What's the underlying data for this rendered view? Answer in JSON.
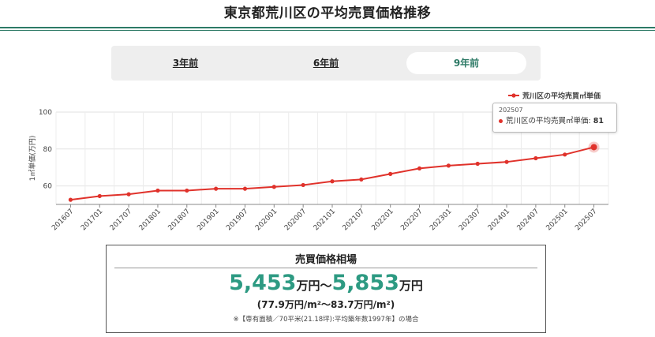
{
  "page": {
    "title": "東京都荒川区の平均売買価格推移"
  },
  "tabs": [
    {
      "label": "3年前",
      "active": false
    },
    {
      "label": "6年前",
      "active": false
    },
    {
      "label": "9年前",
      "active": true
    }
  ],
  "colors": {
    "accent": "#2d7a66",
    "series": "#e0322b",
    "price": "#2d9a82"
  },
  "chart_data": {
    "type": "line",
    "title": "",
    "xlabel": "",
    "ylabel": "1㎡単価(万円)",
    "ylim": [
      50,
      100
    ],
    "yticks": [
      60,
      80,
      100
    ],
    "grid": true,
    "legend_position": "top-right",
    "categories": [
      "201607",
      "201701",
      "201707",
      "201801",
      "201807",
      "201901",
      "201907",
      "202001",
      "202007",
      "202101",
      "202107",
      "202201",
      "202207",
      "202301",
      "202307",
      "202401",
      "202407",
      "202501",
      "202507"
    ],
    "series": [
      {
        "name": "荒川区の平均売買㎡単価",
        "values": [
          52.5,
          54.5,
          55.5,
          57.5,
          57.5,
          58.5,
          58.5,
          59.5,
          60.5,
          62.5,
          63.5,
          66.5,
          69.5,
          71.0,
          72.0,
          73.0,
          75.0,
          77.0,
          81.0
        ]
      }
    ]
  },
  "tooltip": {
    "date": "202507",
    "label": "荒川区の平均売買㎡単価:",
    "value": "81"
  },
  "price_box": {
    "title": "売買価格相場",
    "low": "5,453",
    "low_unit": "万円",
    "tilde": "〜",
    "high": "5,853",
    "high_unit": "万円",
    "per_m2": "(77.9万円/m²〜83.7万円/m²)",
    "note": "※【専有面積／70平米(21.18坪):平均築年数1997年】の場合"
  }
}
